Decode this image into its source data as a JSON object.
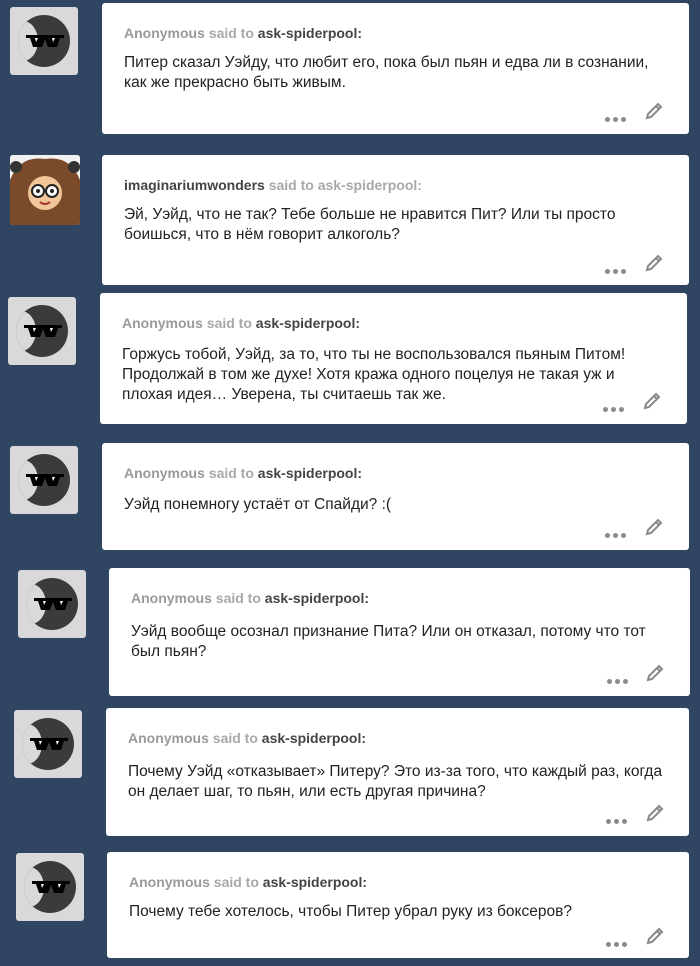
{
  "posts": [
    {
      "asker": "Anonymous",
      "said": " said to ",
      "recipient": "ask-spiderpool:",
      "message": "Питер сказал Уэйду, что любит его, пока был пьян и едва ли в сознании, как же прекрасно быть живым.",
      "avatar": "anonymous-sunglasses-avatar"
    },
    {
      "asker": "imaginariumwonders",
      "said": " said to ",
      "recipient": "ask-spiderpool:",
      "message": "Эй, Уэйд, что не так? Тебе больше не нравится Пит? Или ты просто боишься, что в нём говорит алкоголь?",
      "avatar": "imaginariumwonders-avatar"
    },
    {
      "asker": "Anonymous",
      "said": " said to ",
      "recipient": "ask-spiderpool:",
      "message": "Горжусь тобой, Уэйд, за то, что ты не воспользовался пьяным Питом! Продолжай в том же духе! Хотя кража одного поцелуя не такая уж и плохая идея… Уверена, ты считаешь так же.",
      "avatar": "anonymous-sunglasses-avatar"
    },
    {
      "asker": "Anonymous",
      "said": " said to ",
      "recipient": "ask-spiderpool:",
      "message": "Уэйд понемногу устаёт от Спайди? :(",
      "avatar": "anonymous-sunglasses-avatar"
    },
    {
      "asker": "Anonymous",
      "said": " said to ",
      "recipient": "ask-spiderpool:",
      "message": "Уэйд вообще осознал признание Пита? Или он отказал, потому что тот был пьян?",
      "avatar": "anonymous-sunglasses-avatar"
    },
    {
      "asker": "Anonymous",
      "said": " said to ",
      "recipient": "ask-spiderpool:",
      "message": "Почему Уэйд «отказывает» Питеру? Это из-за того, что каждый раз, когда он делает шаг, то пьян, или есть другая причина?",
      "avatar": "anonymous-sunglasses-avatar"
    },
    {
      "asker": "Anonymous",
      "said": " said to ",
      "recipient": "ask-spiderpool:",
      "message": "Почему тебе хотелось, чтобы Питер убрал руку из боксеров?",
      "avatar": "anonymous-sunglasses-avatar"
    }
  ],
  "colors": {
    "background": "#2f4562",
    "card": "#ffffff",
    "asker": "#9a9a9a",
    "user": "#444444"
  },
  "icons": {
    "more": "more-dots-icon",
    "edit": "pencil-edit-icon"
  }
}
